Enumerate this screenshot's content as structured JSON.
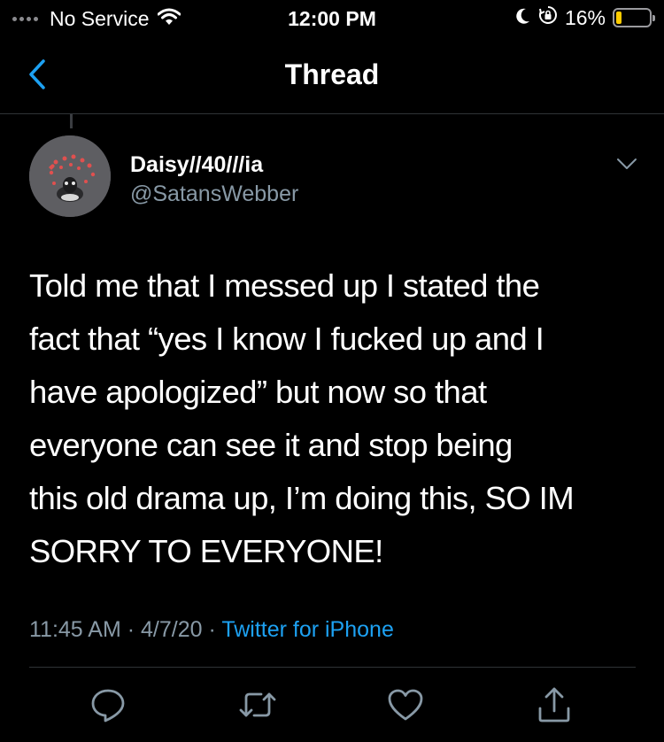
{
  "status_bar": {
    "carrier": "No Service",
    "time": "12:00 PM",
    "battery_percent": "16%",
    "battery_level": 0.16,
    "battery_color": "#ffcc00",
    "icons": [
      "signal-dots-icon",
      "wifi-icon",
      "moon-icon",
      "orientation-lock-icon",
      "battery-icon"
    ]
  },
  "nav": {
    "title": "Thread",
    "back_icon": "chevron-left-icon",
    "accent_color": "#1da1f2"
  },
  "tweet": {
    "display_name": "Daisy//40///ia",
    "handle": "@SatansWebber",
    "text": "Told me that I messed up I stated the\nfact that “yes I know I fucked up and I\nhave apologized” but now so that\neveryone can see it and stop being\nthis old drama up, I’m doing this, SO IM\nSORRY TO EVERYONE!",
    "time": "11:45 AM",
    "separator": "·",
    "date": "4/7/20",
    "source": "Twitter for iPhone"
  },
  "actions": [
    "reply-icon",
    "retweet-icon",
    "like-icon",
    "share-icon"
  ],
  "colors": {
    "background": "#000000",
    "text": "#ffffff",
    "secondary_text": "#8899a6",
    "link": "#1da1f2",
    "divider": "#2f3336"
  }
}
